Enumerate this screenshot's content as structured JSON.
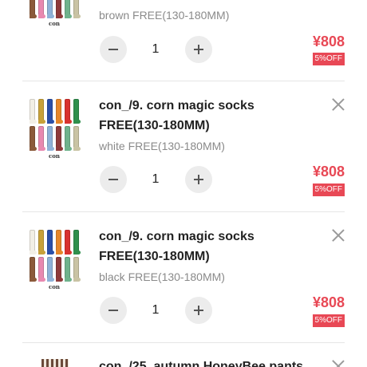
{
  "colors": {
    "accent": "#e84855",
    "muted_text": "#8a8a8a",
    "divider": "#e6e6e6",
    "stepper_bg": "#ececec"
  },
  "thumbnail": {
    "brand": "con",
    "top_row_colors": [
      "#f2efe6",
      "#c8a13a",
      "#2b4fa8",
      "#e6862a",
      "#d8332f",
      "#2f8f4c"
    ],
    "bottom_row_colors": [
      "#8b5a3a",
      "#e889b0",
      "#8fb2d8",
      "#8e3a3a",
      "#6fb28c",
      "#c9c3a4"
    ]
  },
  "cart": {
    "items": [
      {
        "title": "",
        "variant": "brown FREE(130-180MM)",
        "quantity": "1",
        "price": "¥808",
        "discount": "5%OFF"
      },
      {
        "title": "con_/9. corn magic socks FREE(130-180MM)",
        "variant": "white FREE(130-180MM)",
        "quantity": "1",
        "price": "¥808",
        "discount": "5%OFF"
      },
      {
        "title": "con_/9. corn magic socks FREE(130-180MM)",
        "variant": "black FREE(130-180MM)",
        "quantity": "1",
        "price": "¥808",
        "discount": "5%OFF"
      },
      {
        "title": "con_/25. autumn HoneyBee pants"
      }
    ]
  },
  "icons": {
    "remove": "close-icon",
    "decrease": "minus-icon",
    "increase": "plus-icon"
  }
}
